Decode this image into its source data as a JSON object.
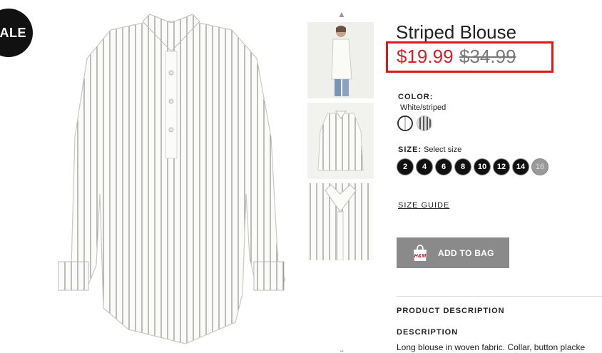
{
  "badge": {
    "sale_label": "SALE"
  },
  "product": {
    "title": "Striped Blouse",
    "sale_price": "$19.99",
    "original_price": "$34.99"
  },
  "color": {
    "label": "COLOR:",
    "value": "White/striped",
    "swatches": [
      "white-solid",
      "grey-striped"
    ]
  },
  "size": {
    "label": "SIZE:",
    "hint": "Select size",
    "options": [
      {
        "label": "2",
        "available": true
      },
      {
        "label": "4",
        "available": true
      },
      {
        "label": "6",
        "available": true
      },
      {
        "label": "8",
        "available": true
      },
      {
        "label": "10",
        "available": true
      },
      {
        "label": "12",
        "available": true
      },
      {
        "label": "14",
        "available": true
      },
      {
        "label": "16",
        "available": false
      }
    ]
  },
  "size_guide_label": "SIZE GUIDE",
  "add_to_bag": {
    "label": "ADD TO BAG",
    "brand_mark": "H&M"
  },
  "description": {
    "section_heading": "PRODUCT DESCRIPTION",
    "heading": "DESCRIPTION",
    "text": "Long blouse in woven fabric. Collar, button placke"
  },
  "colors": {
    "sale_red": "#d2232a",
    "highlight_box": "#e0161b",
    "button_grey": "#8a8a8a"
  }
}
